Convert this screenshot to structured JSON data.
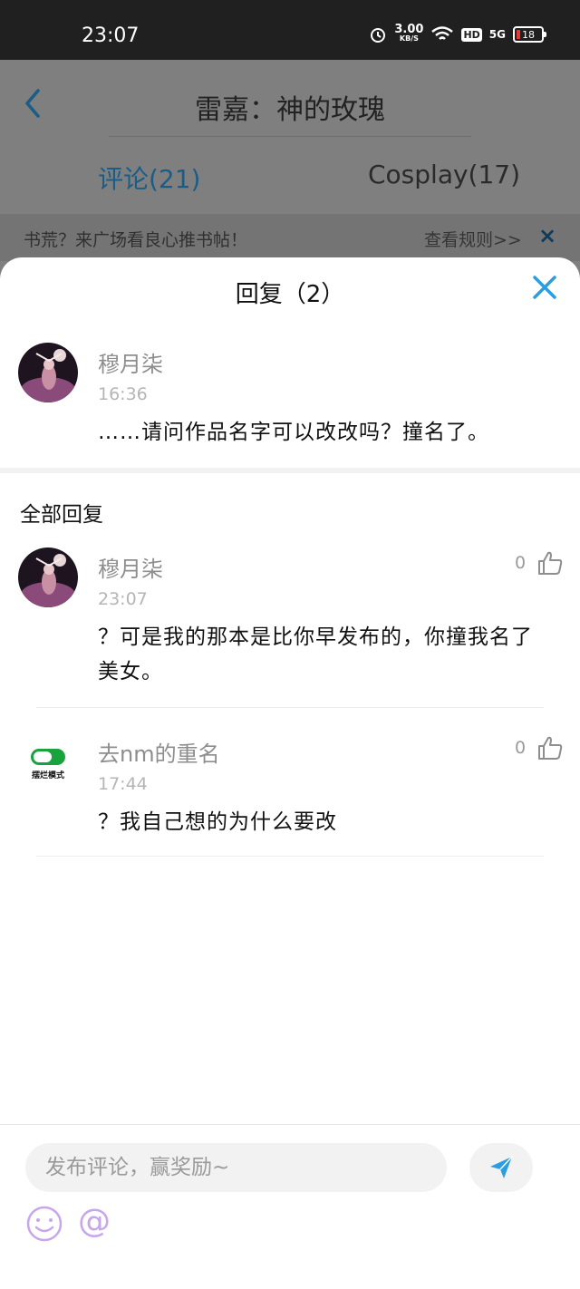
{
  "status": {
    "time": "23:07",
    "speed_value": "3.00",
    "speed_unit": "KB/S",
    "hd": "HD",
    "network": "5G",
    "battery": "18"
  },
  "nav": {
    "title": "雷嘉：神的玫瑰"
  },
  "tabs": [
    {
      "label": "评论(21)",
      "active": true
    },
    {
      "label": "Cosplay(17)",
      "active": false
    }
  ],
  "banner": {
    "text": "书荒？来广场看良心推书帖！",
    "link": "查看规则>>",
    "close": "×"
  },
  "sheet": {
    "title": "回复（2）",
    "original": {
      "username": "穆月柒",
      "time": "16:36",
      "content": "……请问作品名字可以改改吗？撞名了。"
    },
    "section_title": "全部回复",
    "replies": [
      {
        "username": "穆月柒",
        "time": "23:07",
        "likes": "0",
        "content_line1": "？可是我的那本是比你早发布的，你撞我名了",
        "content_line2": "美女。"
      },
      {
        "username": "去nm的重名",
        "time": "17:44",
        "likes": "0",
        "content_line1": "？我自己想的为什么要改",
        "avatar_text": "摆烂模式"
      }
    ]
  },
  "compose": {
    "placeholder": "发布评论，赢奖励~",
    "at_symbol": "@"
  },
  "colors": {
    "accent": "#2a9ee0",
    "tab_active": "#1a5d86",
    "emoji": "#c8a6ec"
  }
}
